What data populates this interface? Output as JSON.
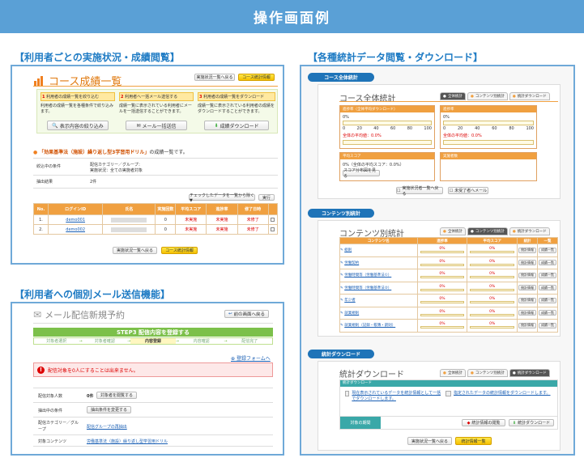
{
  "header": {
    "title": "操作画面例"
  },
  "sections": {
    "grades": "【利用者ごとの実施状況・成績閲覧】",
    "mail": "【利用者への個別メール送信機能】",
    "stats": "【各種統計データ閲覧・ダウンロード】"
  },
  "grades": {
    "title": "コース成績一覧",
    "btn_back": "実施状況一覧へ戻る",
    "btn_stats": "コース統計情報",
    "features": [
      {
        "num": "1",
        "head": "利用者の成績一覧を絞り込む",
        "desc": "利用者の成績一覧を各種条件で絞り込みます。"
      },
      {
        "num": "2",
        "head": "利用者へ一括メール送信する",
        "desc": "成績一覧に表示されている利用者にメールを一括送信することができます。"
      },
      {
        "num": "3",
        "head": "利用者の成績一覧をダウンロード",
        "desc": "成績一覧に表示されている利用者の成績をダウンロードすることができます。"
      }
    ],
    "btn_filter": "表示内容の絞り込み",
    "btn_mail": "メール一括送信",
    "btn_download": "成績ダウンロード",
    "course_name": "「効果基準法（施設）繰り返し型3学習用ドリル」",
    "course_suffix": "の成績一覧です。",
    "cond_label": "絞込中の条件",
    "cond_value1": "配信カテゴリー／グループ：",
    "cond_value2": "実施状況：全ての実施者対象",
    "count_label": "抽出結果",
    "count_value": "2件",
    "check_select": "チェックしたデータを一覧から除く ▼",
    "check_exec": "実行",
    "cols": [
      "No.",
      "ログインID",
      "氏名",
      "実施回数",
      "平均スコア",
      "進捗率",
      "修了日時",
      ""
    ],
    "rows": [
      {
        "no": "1.",
        "login": "demo001",
        "count": "0",
        "avg": "未実施",
        "prog": "未実施",
        "done": "未修了"
      },
      {
        "no": "2.",
        "login": "demo002",
        "count": "0",
        "avg": "未実施",
        "prog": "未実施",
        "done": "未修了"
      }
    ],
    "btn_back_bottom": "実施状況一覧へ戻る",
    "btn_stats_bottom": "コース統計情報"
  },
  "mail": {
    "title": "メール配信新規予約",
    "btn_back": "前の画面へ戻る",
    "step_title": "STEP3 配信内容を登録する",
    "steps": [
      "対象者選択",
      "対象者確認",
      "内容登録",
      "内容確認",
      "配信完了"
    ],
    "link_register": "登録フォームへ",
    "error": "配信対象を0人にすることは出来ません。",
    "f1_label": "配信対象人数",
    "f1_value": "0件",
    "f1_btn": "対象者を閲覧する",
    "f2_label": "抽出中の条件",
    "f2_btn": "抽出条件を変更する",
    "f3_label": "配信カテゴリー／グループ",
    "f3_value": "配信グループの再抽出",
    "f4_label": "対象コンテンツ",
    "f4_value": "労働基準法（施設）繰り返し型学習用ドリル"
  },
  "stats": {
    "pill1": "コース全体統計",
    "pill2": "コンテンツ別統計",
    "pill3": "統計ダウンロード",
    "tabs": [
      "全体統計",
      "コンテンツ別統計",
      "統計ダウンロード"
    ],
    "overall": {
      "title": "コース全体統計",
      "left_head": "進捗率（全体平均ダウンロード）",
      "right_head": "進捗率",
      "ticks": [
        "0",
        "20",
        "40",
        "60",
        "80",
        "100"
      ],
      "avg_left": "全体の平均値：0.0%",
      "avg_right": "全体の平均値：0.0%",
      "score_head": "平均スコア",
      "score_text": "0%（全体の平均スコア：0.0%）",
      "count_head": "実施者数",
      "score_btn": "スコア分布図を見る",
      "btn_return": "実施状況者一覧へ戻る",
      "btn_unused": "未受了者へメール"
    },
    "contents": {
      "title": "コンテンツ別統計",
      "cols": [
        "コンテンツ名",
        "進捗率",
        "平均スコア",
        "統計",
        "一覧"
      ],
      "rows": [
        "総則",
        "労働契約",
        "労働時間等（労働基準法①）",
        "労働時間等（労働基準法②）",
        "年少者",
        "就業規則",
        "就業規則（記録・帳簿・罰則）"
      ],
      "prog": "0%",
      "score": "0%",
      "btn_stat": "統計情報",
      "btn_list": "成績一覧"
    },
    "download": {
      "title": "統計ダウンロード",
      "head": "統計ダウンロード",
      "item1": "現在表示されているデータを統計情報として一括でダウンロードします。",
      "item2": "指定されたデータの統計情報をダウンロードします。",
      "label": "対象の期間",
      "btn_prog": "統計情報の閲覧",
      "btn_dl": "統計ダウンロード",
      "btn_back": "実施状況一覧へ戻る",
      "btn_next": "統計情報一覧"
    }
  },
  "colors": {
    "accent": "#5aa0d6",
    "section": "#1e7bc4",
    "orange": "#f0a040",
    "green": "#7cc04a"
  }
}
